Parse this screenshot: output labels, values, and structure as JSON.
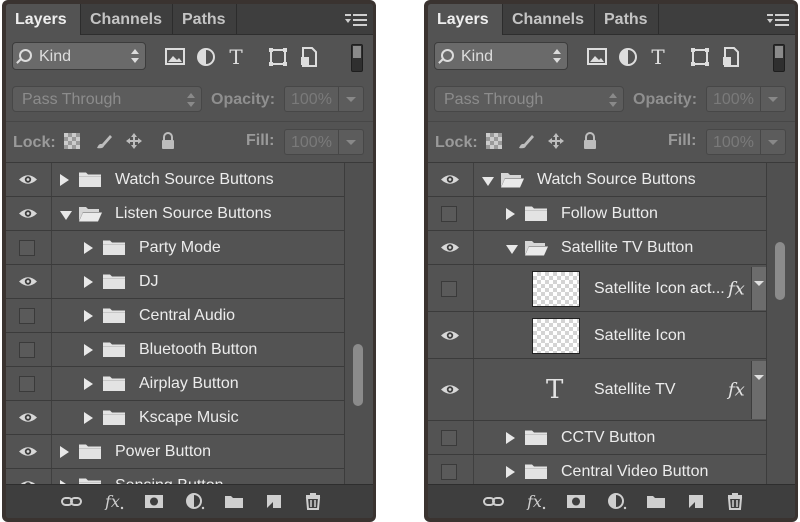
{
  "panels": [
    {
      "tabs": [
        {
          "label": "Layers",
          "active": true
        },
        {
          "label": "Channels",
          "active": false
        },
        {
          "label": "Paths",
          "active": false
        }
      ],
      "filter": {
        "kind_label": "Kind",
        "icons": [
          "image-filter-icon",
          "adjustment-filter-icon",
          "type-filter-icon",
          "shape-filter-icon",
          "smart-object-filter-icon"
        ]
      },
      "blend_mode": "Pass Through",
      "opacity_label": "Opacity:",
      "opacity_value": "100%",
      "lock_label": "Lock:",
      "lock_icons": [
        "lock-transparent-pixels-icon",
        "lock-image-pixels-icon",
        "lock-position-icon",
        "lock-all-icon"
      ],
      "fill_label": "Fill:",
      "fill_value": "100%",
      "scroll_position": 0.7,
      "layers": [
        {
          "name": "Watch Source Buttons",
          "visible": true,
          "type": "group",
          "expanded": false,
          "depth": 0
        },
        {
          "name": "Listen Source Buttons",
          "visible": true,
          "type": "group",
          "expanded": true,
          "depth": 0
        },
        {
          "name": "Party Mode",
          "visible": false,
          "type": "group",
          "expanded": false,
          "depth": 1
        },
        {
          "name": "DJ",
          "visible": true,
          "type": "group",
          "expanded": false,
          "depth": 1
        },
        {
          "name": "Central Audio",
          "visible": false,
          "type": "group",
          "expanded": false,
          "depth": 1
        },
        {
          "name": "Bluetooth Button",
          "visible": false,
          "type": "group",
          "expanded": false,
          "depth": 1
        },
        {
          "name": "Airplay Button",
          "visible": false,
          "type": "group",
          "expanded": false,
          "depth": 1
        },
        {
          "name": "Kscape Music",
          "visible": true,
          "type": "group",
          "expanded": false,
          "depth": 1
        },
        {
          "name": "Power Button",
          "visible": true,
          "type": "group",
          "expanded": false,
          "depth": 0
        },
        {
          "name": "Sensing Button",
          "visible": true,
          "type": "group",
          "expanded": false,
          "depth": 0
        }
      ],
      "footer_icons": [
        "link-layers-icon",
        "fx-icon",
        "layer-mask-icon",
        "adjustment-layer-icon",
        "new-group-icon",
        "new-layer-icon",
        "trash-icon"
      ]
    },
    {
      "tabs": [
        {
          "label": "Layers",
          "active": true
        },
        {
          "label": "Channels",
          "active": false
        },
        {
          "label": "Paths",
          "active": false
        }
      ],
      "filter": {
        "kind_label": "Kind",
        "icons": [
          "image-filter-icon",
          "adjustment-filter-icon",
          "type-filter-icon",
          "shape-filter-icon",
          "smart-object-filter-icon"
        ]
      },
      "blend_mode": "Pass Through",
      "opacity_label": "Opacity:",
      "opacity_value": "100%",
      "lock_label": "Lock:",
      "lock_icons": [
        "lock-transparent-pixels-icon",
        "lock-image-pixels-icon",
        "lock-position-icon",
        "lock-all-icon"
      ],
      "fill_label": "Fill:",
      "fill_value": "100%",
      "scroll_position": 0.3,
      "layers": [
        {
          "name": "Watch Source Buttons",
          "visible": true,
          "type": "group",
          "expanded": true,
          "depth": 0
        },
        {
          "name": "Follow Button",
          "visible": false,
          "type": "group",
          "expanded": false,
          "depth": 1
        },
        {
          "name": "Satellite TV Button",
          "visible": true,
          "type": "group",
          "expanded": true,
          "depth": 1
        },
        {
          "name": "Satellite Icon act...",
          "visible": false,
          "type": "pixel",
          "fx": true,
          "depth": 2
        },
        {
          "name": "Satellite Icon",
          "visible": true,
          "type": "pixel",
          "fx": false,
          "depth": 2
        },
        {
          "name": "Satellite TV",
          "visible": true,
          "type": "text",
          "fx": true,
          "depth": 2
        },
        {
          "name": "CCTV Button",
          "visible": false,
          "type": "group",
          "expanded": false,
          "depth": 1
        },
        {
          "name": "Central Video Button",
          "visible": false,
          "type": "group",
          "expanded": false,
          "depth": 1
        }
      ],
      "footer_icons": [
        "link-layers-icon",
        "fx-icon",
        "layer-mask-icon",
        "adjustment-layer-icon",
        "new-group-icon",
        "new-layer-icon",
        "trash-icon"
      ]
    }
  ]
}
